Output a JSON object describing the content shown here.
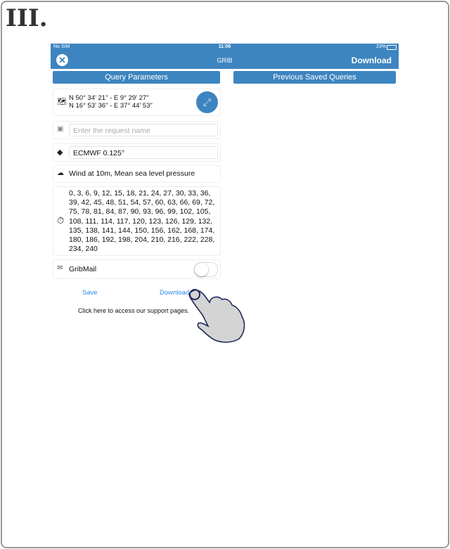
{
  "step_label": "III.",
  "status": {
    "carrier": "No SIM",
    "time": "11:06",
    "battery": "23%"
  },
  "nav": {
    "title": "GRIB",
    "download_label": "Download"
  },
  "tabs": [
    {
      "label": "Query Parameters"
    },
    {
      "label": "Previous Saved Queries"
    }
  ],
  "coords": {
    "line1": "N 50° 34' 21\" - E 9° 29' 27\"",
    "line2": "N 16° 53' 36\" - E 37° 44' 53\""
  },
  "request_name": {
    "value": "",
    "placeholder": "Enter the request name"
  },
  "model": "ECMWF 0.125°",
  "parameters": "Wind at 10m, Mean sea level pressure",
  "time_steps": "0, 3, 6, 9, 12, 15, 18, 21, 24, 27, 30, 33, 36, 39, 42, 45, 48, 51, 54, 57, 60, 63, 66, 69, 72, 75, 78, 81, 84, 87, 90, 93, 96, 99, 102, 105, 108, 111, 114, 117, 120, 123, 126, 129, 132, 135, 138, 141, 144, 150, 156, 162, 168, 174, 180, 186, 192, 198, 204, 210, 216, 222, 228, 234, 240",
  "gribmail": {
    "label": "GribMail",
    "enabled": false
  },
  "actions": {
    "save": "Save",
    "download": "Download"
  },
  "support_text": "Click here to access our support pages.",
  "colors": {
    "accent": "#3d85c0",
    "link": "#2e8ae6"
  }
}
